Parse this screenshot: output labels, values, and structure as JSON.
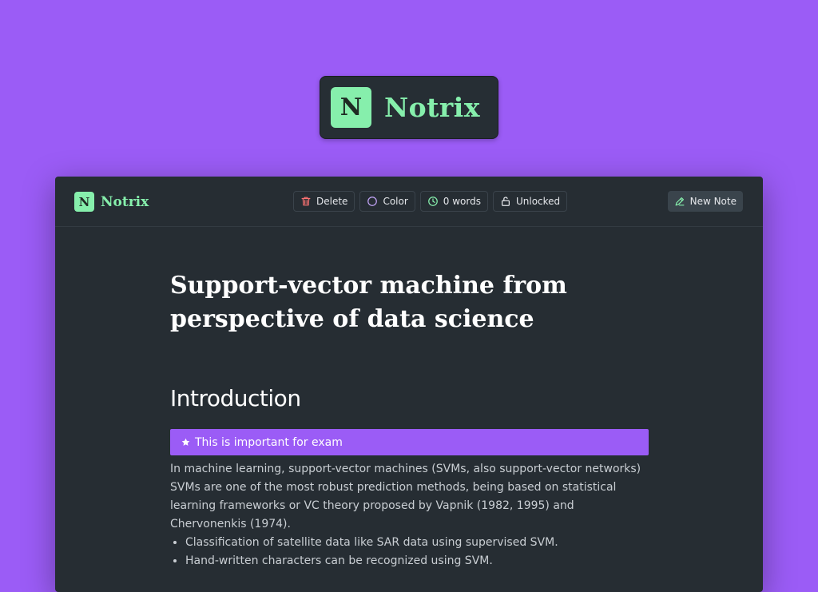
{
  "hero": {
    "logo_letter": "N",
    "logo_text": "Notrix"
  },
  "toolbar": {
    "brand_letter": "N",
    "brand_text": "Notrix",
    "delete_label": "Delete",
    "color_label": "Color",
    "word_count_label": "0 words",
    "lock_label": "Unlocked",
    "new_note_label": "New Note"
  },
  "document": {
    "title": "Support-vector machine from perspective of data science",
    "section_heading": "Introduction",
    "callout_text": "This is important for exam",
    "paragraph": "In machine learning, support-vector machines (SVMs, also support-vector networks) SVMs are one of the most robust prediction methods, being based on statistical learning frameworks or VC theory proposed by Vapnik (1982, 1995) and Chervonenkis (1974).",
    "bullets": [
      "Classification of satellite data like SAR data using supervised SVM.",
      "Hand-written characters can be recognized using SVM."
    ]
  },
  "icons": {
    "delete": "trash-icon",
    "color": "circle-icon",
    "words": "clock-icon",
    "lock": "unlock-icon",
    "new_note": "pen-icon",
    "callout": "star-icon"
  },
  "colors": {
    "accent": "#9b5cf6",
    "brand_green": "#86efac",
    "window_bg": "#262d33",
    "delete_red": "#f87171",
    "color_purple": "#c4a5f9",
    "words_green": "#86efac"
  }
}
